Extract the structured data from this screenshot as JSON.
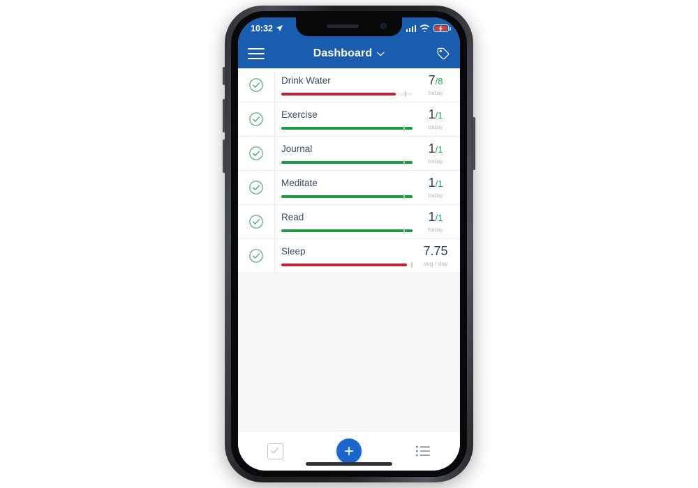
{
  "device": {
    "name": "iphone-x",
    "frame_color": "#2d2f33"
  },
  "status_bar": {
    "time": "10:32",
    "location_icon": "location-arrow-icon",
    "signal_icon": "cellular-signal-icon",
    "wifi_icon": "wifi-icon",
    "battery_icon": "battery-charging-icon",
    "battery_color": "#d93c3c",
    "background": "#1a5cad"
  },
  "header": {
    "menu_icon": "hamburger-menu-icon",
    "title": "Dashboard",
    "chevron_icon": "chevron-down-icon",
    "tag_icon": "tag-icon",
    "background": "#1a5cad"
  },
  "habits": [
    {
      "check_icon": "check-circle-icon",
      "name": "Drink Water",
      "value": "7",
      "denominator": "/8",
      "sub": "today",
      "progress": 87,
      "bar_color": "#c62033",
      "marker": 94
    },
    {
      "check_icon": "check-circle-icon",
      "name": "Exercise",
      "value": "1",
      "denominator": "/1",
      "sub": "today",
      "progress": 100,
      "bar_color": "#1a9c45",
      "marker": 93
    },
    {
      "check_icon": "check-circle-icon",
      "name": "Journal",
      "value": "1",
      "denominator": "/1",
      "sub": "today",
      "progress": 100,
      "bar_color": "#1a9c45",
      "marker": 93
    },
    {
      "check_icon": "check-circle-icon",
      "name": "Meditate",
      "value": "1",
      "denominator": "/1",
      "sub": "today",
      "progress": 100,
      "bar_color": "#1a9c45",
      "marker": 93
    },
    {
      "check_icon": "check-circle-icon",
      "name": "Read",
      "value": "1",
      "denominator": "/1",
      "sub": "today",
      "progress": 100,
      "bar_color": "#1a9c45",
      "marker": 93
    },
    {
      "check_icon": "check-circle-icon",
      "name": "Sleep",
      "value": "7.75",
      "denominator": "",
      "sub": "avg / day",
      "progress": 96,
      "bar_color": "#c62033",
      "marker": 99
    }
  ],
  "bottom_nav": {
    "items": [
      {
        "icon": "checkbox-icon",
        "name": "nav-checkbox"
      },
      {
        "icon": "plus-icon",
        "name": "nav-add",
        "color": "#1a66cc"
      },
      {
        "icon": "list-icon",
        "name": "nav-list"
      }
    ]
  },
  "colors": {
    "header_blue": "#1a5cad",
    "accent_blue": "#1a66cc",
    "green": "#1a9c45",
    "red": "#c62033",
    "text_navy": "#3b4a66"
  }
}
